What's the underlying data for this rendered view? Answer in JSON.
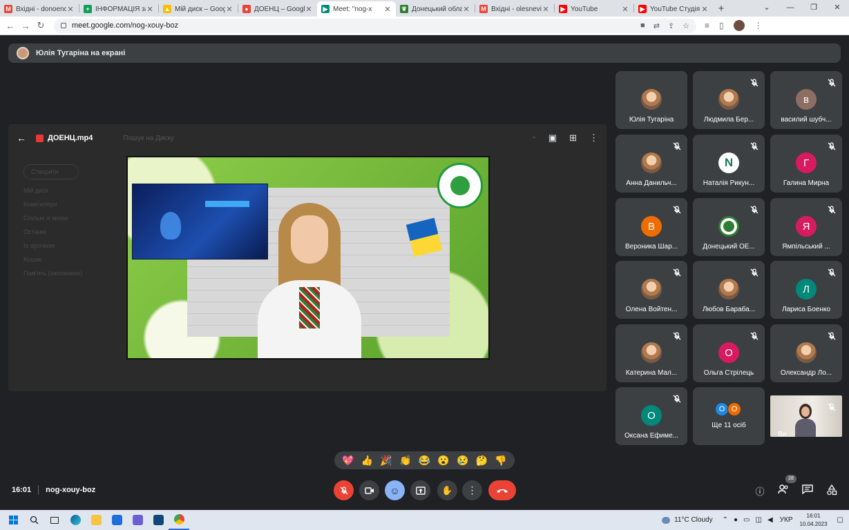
{
  "browser": {
    "tabs": [
      {
        "title": "Вхідні - donoencb",
        "fav": "M",
        "favcolor": "#ea4335",
        "active": false
      },
      {
        "title": "ІНФОРМАЦІЯ за",
        "fav": "+",
        "favcolor": "#0f9d58",
        "active": false
      },
      {
        "title": "Мій диск – Google",
        "fav": "▲",
        "favcolor": "#fbbc04",
        "active": false
      },
      {
        "title": "ДОЕНЦ – Google",
        "fav": "●",
        "favcolor": "#ea4335",
        "active": false
      },
      {
        "title": "Meet: \"nog-x",
        "fav": "▶",
        "favcolor": "#00897b",
        "active": true
      },
      {
        "title": "Донецький облас",
        "fav": "❦",
        "favcolor": "#2e7d32",
        "active": false
      },
      {
        "title": "Вхідні - olesnevic",
        "fav": "M",
        "favcolor": "#ea4335",
        "active": false
      },
      {
        "title": "YouTube",
        "fav": "▶",
        "favcolor": "#ff0000",
        "active": false
      },
      {
        "title": "YouTube Студія",
        "fav": "▶",
        "favcolor": "#ff0000",
        "active": false
      }
    ],
    "new_tab": "+",
    "url": "meet.google.com/nog-xouy-boz"
  },
  "presenter": {
    "label": "Юлія Тугаріна на екрані"
  },
  "shared_screen": {
    "file_name": "ДОЕНЦ.mp4",
    "search_ghost": "Пошук на Диску",
    "create_ghost": "Створити",
    "side_ghost": [
      "Мій диск",
      "Комп'ютери",
      "Спільні зі мною",
      "Останні",
      "Із зірочкою",
      "Кошик",
      "Пам'ять (заповнено)"
    ]
  },
  "participants": [
    {
      "name": "Юлія Тугаріна",
      "initial": "",
      "color": "",
      "photo": true,
      "muted": false
    },
    {
      "name": "Людмила Бер...",
      "initial": "",
      "color": "",
      "photo": true,
      "muted": true
    },
    {
      "name": "василий шубч...",
      "initial": "в",
      "color": "#8d6e63",
      "photo": false,
      "muted": true
    },
    {
      "name": "Анна Данильч...",
      "initial": "",
      "color": "",
      "photo": true,
      "muted": true
    },
    {
      "name": "Наталія Рикун...",
      "initial": "N",
      "color": "#ffffff",
      "photo": false,
      "muted": true
    },
    {
      "name": "Галина Мирна",
      "initial": "Г",
      "color": "#d81b60",
      "photo": false,
      "muted": true
    },
    {
      "name": "Вероника Шар...",
      "initial": "В",
      "color": "#ef6c00",
      "photo": false,
      "muted": true
    },
    {
      "name": "Донецький ОЕ...",
      "initial": "",
      "color": "#2e7d32",
      "photo": false,
      "muted": true
    },
    {
      "name": "Ямпільський ...",
      "initial": "Я",
      "color": "#d81b60",
      "photo": false,
      "muted": true
    },
    {
      "name": "Олена Войтен...",
      "initial": "",
      "color": "",
      "photo": true,
      "muted": true
    },
    {
      "name": "Любов Бараба...",
      "initial": "",
      "color": "",
      "photo": true,
      "muted": true
    },
    {
      "name": "Лариса Боенко",
      "initial": "Л",
      "color": "#00897b",
      "photo": false,
      "muted": true
    },
    {
      "name": "Катерина Мал...",
      "initial": "",
      "color": "",
      "photo": true,
      "muted": true
    },
    {
      "name": "Ольга Стрілець",
      "initial": "О",
      "color": "#d81b60",
      "photo": false,
      "muted": true
    },
    {
      "name": "Олександр Ло...",
      "initial": "",
      "color": "",
      "photo": true,
      "muted": true
    },
    {
      "name": "Оксана Ефиме...",
      "initial": "О",
      "color": "#00897b",
      "photo": false,
      "muted": true
    }
  ],
  "more_tile": {
    "label": "Ще 11 осіб",
    "avatars": [
      {
        "initial": "О",
        "color": "#1e88e5"
      },
      {
        "initial": "О",
        "color": "#ef6c00"
      }
    ]
  },
  "self_tile": {
    "label": "Ви"
  },
  "reactions": [
    "💖",
    "👍",
    "🎉",
    "👏",
    "😂",
    "😮",
    "😢",
    "🤔",
    "👎"
  ],
  "meeting": {
    "time": "16:01",
    "code": "nog-xouy-boz",
    "participant_count": "28"
  },
  "taskbar": {
    "weather": "11°C  Cloudy",
    "lang": "УКР",
    "clock_time": "16:01",
    "clock_date": "10.04.2023"
  }
}
